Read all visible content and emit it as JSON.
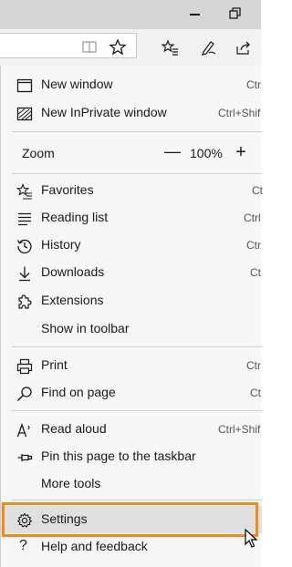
{
  "menu": {
    "items": [
      {
        "label": "New window",
        "shortcut": "Ctr"
      },
      {
        "label": "New InPrivate window",
        "shortcut": "Ctrl+Shif"
      },
      {
        "label": "Favorites",
        "shortcut": "Ct"
      },
      {
        "label": "Reading list",
        "shortcut": "Ctrl"
      },
      {
        "label": "History",
        "shortcut": "Ctr"
      },
      {
        "label": "Downloads",
        "shortcut": "Ct"
      },
      {
        "label": "Extensions",
        "shortcut": ""
      },
      {
        "label": "Show in toolbar",
        "shortcut": ""
      },
      {
        "label": "Print",
        "shortcut": "Ctr"
      },
      {
        "label": "Find on page",
        "shortcut": "Ct"
      },
      {
        "label": "Read aloud",
        "shortcut": "Ctrl+Shif"
      },
      {
        "label": "Pin this page to the taskbar",
        "shortcut": ""
      },
      {
        "label": "More tools",
        "shortcut": ""
      },
      {
        "label": "Settings",
        "shortcut": ""
      },
      {
        "label": "Help and feedback",
        "shortcut": ""
      }
    ],
    "zoom": {
      "label": "Zoom",
      "value": "100%",
      "minus": "—",
      "plus": "+"
    }
  },
  "colors": {
    "highlight": "#f28a1c",
    "menu_bg": "#f7f7f7",
    "selected_bg": "#e0e0e0"
  }
}
